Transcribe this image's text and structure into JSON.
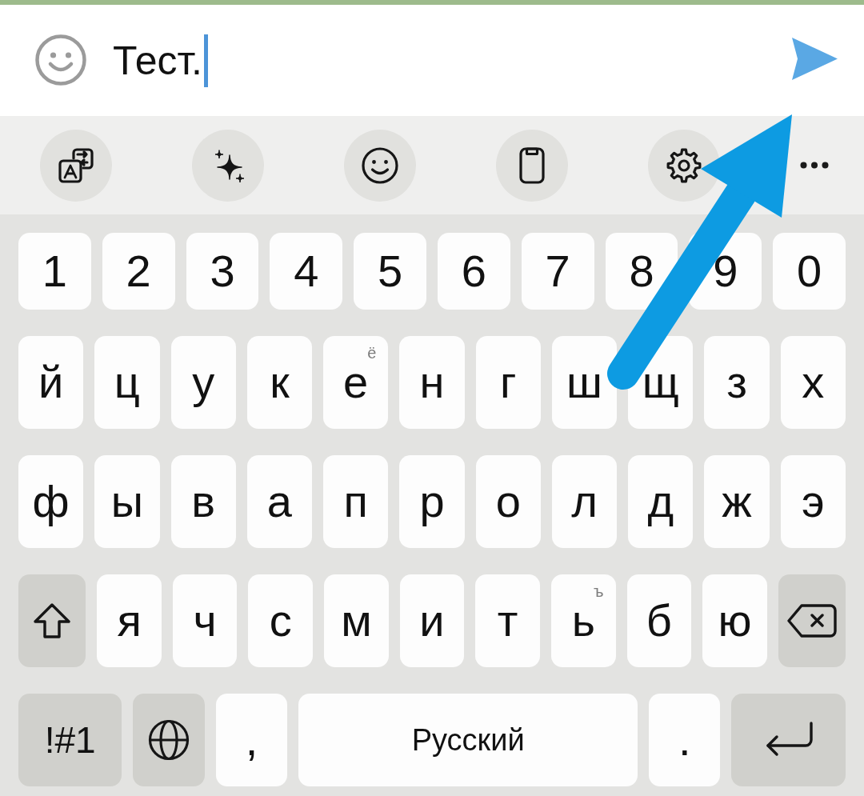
{
  "message_input": {
    "value": "Тест.",
    "focused": true
  },
  "toolbar": {
    "buttons": [
      {
        "kind": "translate"
      },
      {
        "kind": "sparkle"
      },
      {
        "kind": "emoji"
      },
      {
        "kind": "clipboard"
      },
      {
        "kind": "settings"
      },
      {
        "kind": "more"
      }
    ]
  },
  "keyboard": {
    "rows": [
      {
        "keys": [
          {
            "kind": "char",
            "label": "1"
          },
          {
            "kind": "char",
            "label": "2"
          },
          {
            "kind": "char",
            "label": "3"
          },
          {
            "kind": "char",
            "label": "4"
          },
          {
            "kind": "char",
            "label": "5"
          },
          {
            "kind": "char",
            "label": "6"
          },
          {
            "kind": "char",
            "label": "7"
          },
          {
            "kind": "char",
            "label": "8"
          },
          {
            "kind": "char",
            "label": "9"
          },
          {
            "kind": "char",
            "label": "0"
          }
        ]
      },
      {
        "keys": [
          {
            "kind": "char",
            "label": "й"
          },
          {
            "kind": "char",
            "label": "ц"
          },
          {
            "kind": "char",
            "label": "у"
          },
          {
            "kind": "char",
            "label": "к"
          },
          {
            "kind": "char",
            "label": "е",
            "hint": "ё"
          },
          {
            "kind": "char",
            "label": "н"
          },
          {
            "kind": "char",
            "label": "г"
          },
          {
            "kind": "char",
            "label": "ш"
          },
          {
            "kind": "char",
            "label": "щ"
          },
          {
            "kind": "char",
            "label": "з"
          },
          {
            "kind": "char",
            "label": "х"
          }
        ]
      },
      {
        "keys": [
          {
            "kind": "char",
            "label": "ф"
          },
          {
            "kind": "char",
            "label": "ы"
          },
          {
            "kind": "char",
            "label": "в"
          },
          {
            "kind": "char",
            "label": "а"
          },
          {
            "kind": "char",
            "label": "п"
          },
          {
            "kind": "char",
            "label": "р"
          },
          {
            "kind": "char",
            "label": "о"
          },
          {
            "kind": "char",
            "label": "л"
          },
          {
            "kind": "char",
            "label": "д"
          },
          {
            "kind": "char",
            "label": "ж"
          },
          {
            "kind": "char",
            "label": "э"
          }
        ]
      },
      {
        "keys": [
          {
            "kind": "shift"
          },
          {
            "kind": "char",
            "label": "я"
          },
          {
            "kind": "char",
            "label": "ч"
          },
          {
            "kind": "char",
            "label": "с"
          },
          {
            "kind": "char",
            "label": "м"
          },
          {
            "kind": "char",
            "label": "и"
          },
          {
            "kind": "char",
            "label": "т"
          },
          {
            "kind": "char",
            "label": "ь",
            "hint": "ъ"
          },
          {
            "kind": "char",
            "label": "б"
          },
          {
            "kind": "char",
            "label": "ю"
          },
          {
            "kind": "backspace"
          }
        ]
      },
      {
        "keys": [
          {
            "kind": "symbols",
            "label": "!#1"
          },
          {
            "kind": "globe"
          },
          {
            "kind": "char",
            "label": ","
          },
          {
            "kind": "space",
            "label": "Русский"
          },
          {
            "kind": "char",
            "label": "."
          },
          {
            "kind": "enter"
          }
        ]
      }
    ]
  }
}
